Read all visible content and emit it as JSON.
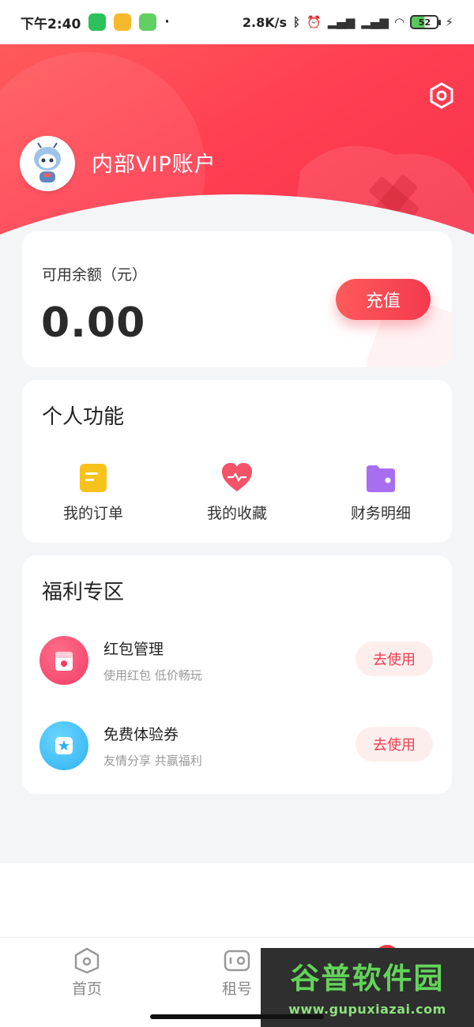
{
  "status_bar": {
    "time": "下午2:40",
    "speed": "2.8K/s",
    "battery": "52"
  },
  "header": {
    "account_name": "内部VIP账户",
    "settings_icon": "settings-hexagon-icon"
  },
  "balance": {
    "label": "可用余额（元）",
    "value": "0.00",
    "recharge_label": "充值"
  },
  "personal_functions": {
    "title": "个人功能",
    "items": [
      {
        "label": "我的订单",
        "icon": "order-icon",
        "color": "#f7c21b"
      },
      {
        "label": "我的收藏",
        "icon": "favorite-heart-icon",
        "color": "#f4536a"
      },
      {
        "label": "财务明细",
        "icon": "wallet-folder-icon",
        "color": "#a86ef0"
      }
    ]
  },
  "welfare": {
    "title": "福利专区",
    "items": [
      {
        "title": "红包管理",
        "subtitle": "使用红包 低价畅玩",
        "button": "去使用",
        "icon": "red-packet-icon",
        "color": "#f23d67"
      },
      {
        "title": "免费体验券",
        "subtitle": "友情分享 共赢福利",
        "button": "去使用",
        "icon": "coupon-icon",
        "color": "#3bbff5"
      }
    ]
  },
  "tabbar": {
    "items": [
      {
        "label": "首页",
        "icon": "home-icon"
      },
      {
        "label": "租号",
        "icon": "gamepad-icon"
      }
    ]
  },
  "watermark": {
    "title": "谷普软件园",
    "url": "www.gupuxiazai.com"
  },
  "colors": {
    "brand_red": "#f23a4e",
    "background": "#f4f5f7"
  }
}
